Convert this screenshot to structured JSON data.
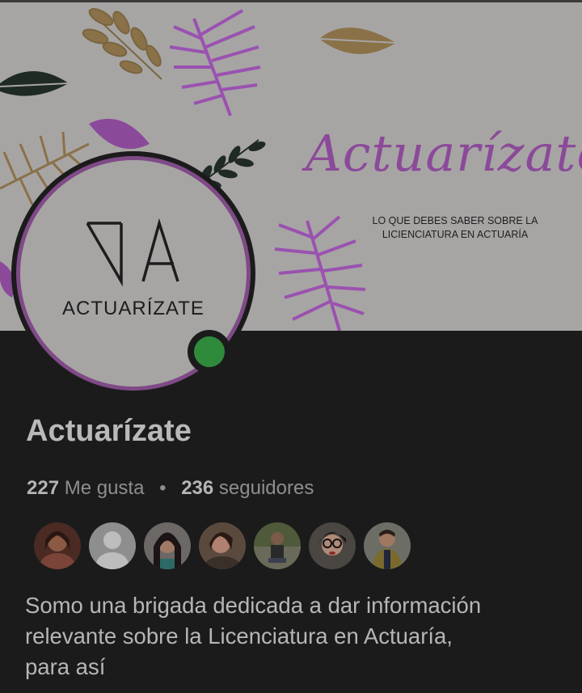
{
  "cover": {
    "title": "Actuarízate",
    "subtitle_line1": "LO QUE DEBES SABER SOBRE LA",
    "subtitle_line2": "LICIENCIATURA EN ACTUARÍA",
    "colors": {
      "background": "#a7a5a4",
      "purple": "#8b4a99",
      "gold": "#8a7148",
      "dark_green": "#1f2a25"
    }
  },
  "avatar": {
    "logo_text": "ACTUARÍZATE",
    "status": "online",
    "status_color": "#2f8a3c"
  },
  "profile": {
    "name": "Actuarízate",
    "likes_count": "227",
    "likes_label": "Me gusta",
    "separator": "•",
    "followers_count": "236",
    "followers_label": "seguidores"
  },
  "friends": [
    {
      "icon": "friend-photo-avatar"
    },
    {
      "icon": "default-person-avatar"
    },
    {
      "icon": "friend-photo-avatar"
    },
    {
      "icon": "friend-photo-avatar"
    },
    {
      "icon": "friend-photo-avatar"
    },
    {
      "icon": "friend-photo-avatar"
    },
    {
      "icon": "friend-photo-avatar"
    }
  ],
  "bio": {
    "line1": "Somo una brigada dedicada a dar información",
    "line2": "relevante sobre la Licenciatura en Actuaría,",
    "line3": "para así"
  }
}
